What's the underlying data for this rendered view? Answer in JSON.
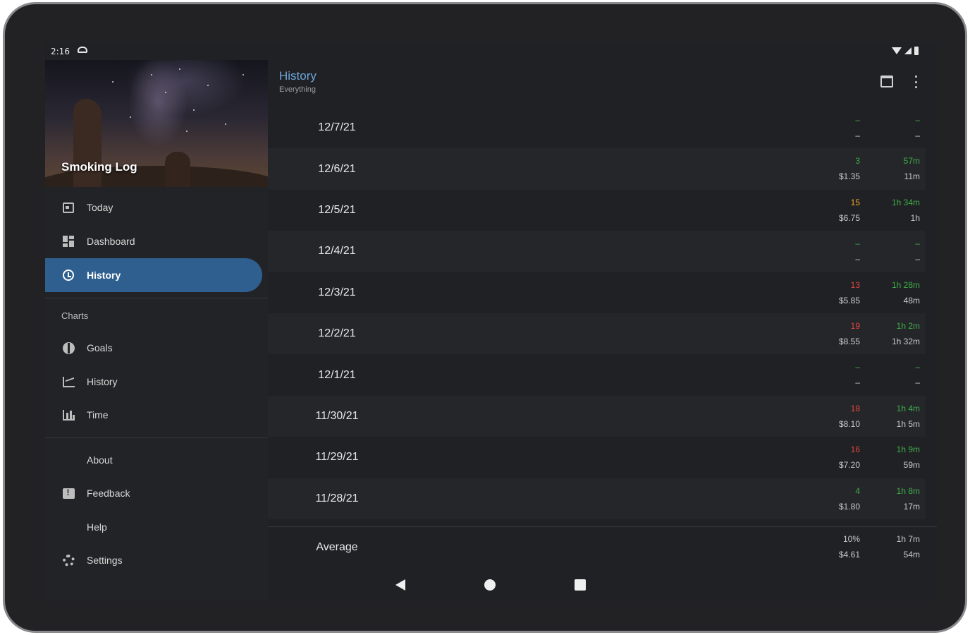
{
  "status": {
    "time": "2:16"
  },
  "drawer": {
    "title": "Smoking Log",
    "items": [
      {
        "label": "Today",
        "icon": "calendar-today-icon"
      },
      {
        "label": "Dashboard",
        "icon": "dashboard-icon"
      },
      {
        "label": "History",
        "icon": "history-icon",
        "active": true
      }
    ],
    "charts_label": "Charts",
    "chart_items": [
      {
        "label": "Goals",
        "icon": "globe-icon"
      },
      {
        "label": "History",
        "icon": "line-chart-icon"
      },
      {
        "label": "Time",
        "icon": "bar-chart-icon"
      }
    ],
    "footer_items": [
      {
        "label": "About",
        "icon": "info-icon"
      },
      {
        "label": "Feedback",
        "icon": "feedback-icon"
      },
      {
        "label": "Help",
        "icon": "help-icon"
      },
      {
        "label": "Settings",
        "icon": "settings-icon"
      }
    ]
  },
  "appbar": {
    "title": "History",
    "subtitle": "Everything"
  },
  "colors": {
    "accent": "#2f5f8f",
    "green": "#3fae49",
    "orange": "#f0a52a",
    "red": "#e0463e",
    "title_blue": "#6fa8dc"
  },
  "rows": [
    {
      "date": "12/7/21",
      "count": "–",
      "cost": "–",
      "gap": "–",
      "gap2": "–",
      "count_color": "green"
    },
    {
      "date": "12/6/21",
      "count": "3",
      "cost": "$1.35",
      "gap": "57m",
      "gap2": "11m",
      "count_color": "green"
    },
    {
      "date": "12/5/21",
      "count": "15",
      "cost": "$6.75",
      "gap": "1h 34m",
      "gap2": "1h",
      "count_color": "orange"
    },
    {
      "date": "12/4/21",
      "count": "–",
      "cost": "–",
      "gap": "–",
      "gap2": "–",
      "count_color": "green"
    },
    {
      "date": "12/3/21",
      "count": "13",
      "cost": "$5.85",
      "gap": "1h 28m",
      "gap2": "48m",
      "count_color": "red"
    },
    {
      "date": "12/2/21",
      "count": "19",
      "cost": "$8.55",
      "gap": "1h 2m",
      "gap2": "1h 32m",
      "count_color": "red"
    },
    {
      "date": "12/1/21",
      "count": "–",
      "cost": "–",
      "gap": "–",
      "gap2": "–",
      "count_color": "green"
    },
    {
      "date": "11/30/21",
      "count": "18",
      "cost": "$8.10",
      "gap": "1h 4m",
      "gap2": "1h 5m",
      "count_color": "red"
    },
    {
      "date": "11/29/21",
      "count": "16",
      "cost": "$7.20",
      "gap": "1h 9m",
      "gap2": "59m",
      "count_color": "red"
    },
    {
      "date": "11/28/21",
      "count": "4",
      "cost": "$1.80",
      "gap": "1h 8m",
      "gap2": "17m",
      "count_color": "green"
    }
  ],
  "average": {
    "label": "Average",
    "count": "10%",
    "cost": "$4.61",
    "gap": "1h 7m",
    "gap2": "54m"
  }
}
